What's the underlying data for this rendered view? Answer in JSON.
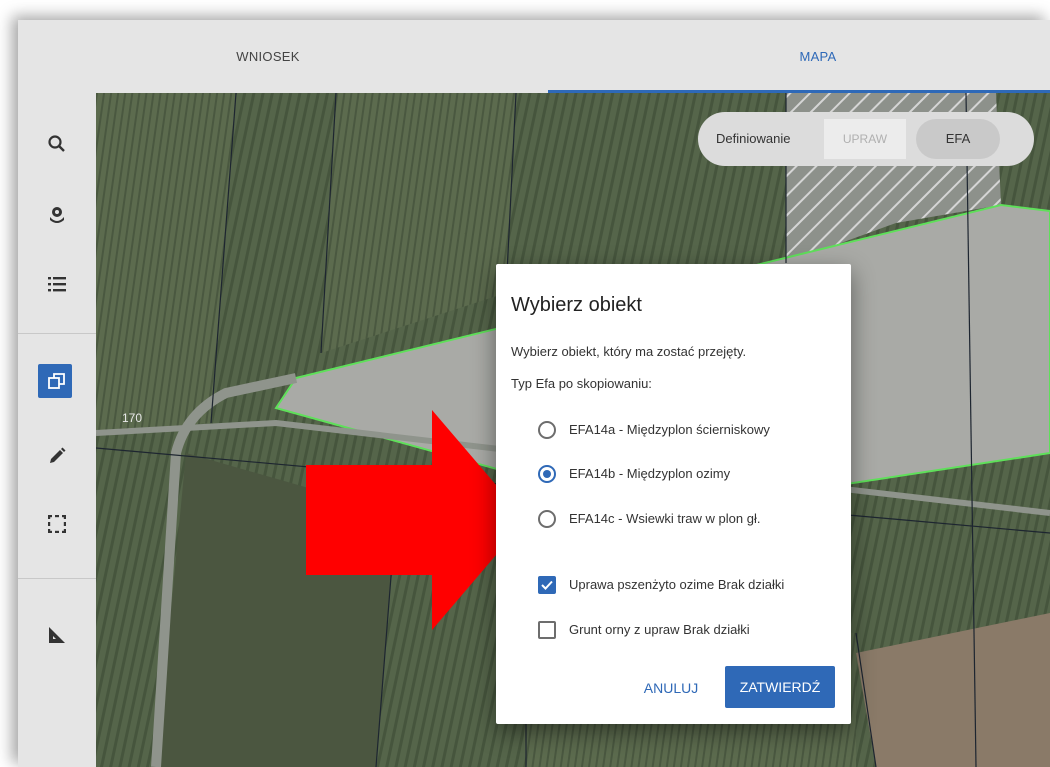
{
  "tabs": [
    {
      "label": "WNIOSEK"
    },
    {
      "label": "MAPA"
    }
  ],
  "sidebar": {
    "icons": [
      "search-icon",
      "plant-icon",
      "list-icon",
      "copy-icon",
      "pencil-icon",
      "select-rectangle-icon",
      "ruler-icon"
    ],
    "active_icon": "copy-icon"
  },
  "map": {
    "parcel_label": "170"
  },
  "toggle": {
    "label": "Definiowanie",
    "option_upraw": "UPRAW",
    "option_efa": "EFA"
  },
  "dialog": {
    "title": "Wybierz obiekt",
    "subtitle": "Wybierz obiekt, który ma zostać przejęty.",
    "type_label": "Typ Efa po skopiowaniu:",
    "options": [
      {
        "label": "EFA14a - Międzyplon ścierniskowy",
        "selected": false
      },
      {
        "label": "EFA14b - Międzyplon ozimy",
        "selected": true
      },
      {
        "label": "EFA14c - Wsiewki traw w plon gł.",
        "selected": false
      }
    ],
    "checkboxes": [
      {
        "label": "Uprawa pszenżyto ozime Brak działki",
        "checked": true
      },
      {
        "label": "Grunt orny z upraw Brak działki",
        "checked": false
      }
    ],
    "cancel_label": "ANULUJ",
    "confirm_label": "ZATWIERDŹ"
  },
  "colors": {
    "accent": "#2f69b7",
    "arrow": "#ff0000",
    "highlight_green": "#5fe05a"
  }
}
